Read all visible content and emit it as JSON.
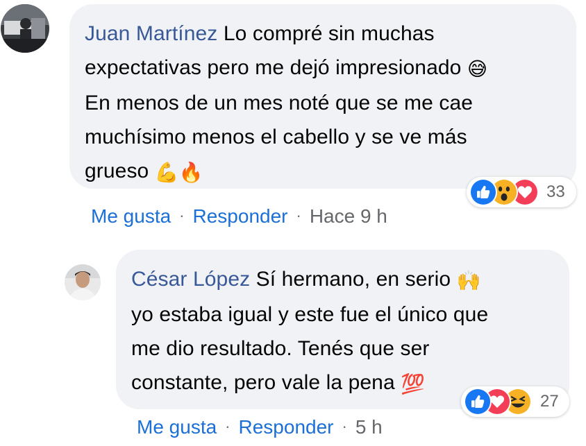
{
  "comments": [
    {
      "author": "Juan Martínez",
      "lines": [
        " Lo compré sin muchas",
        "expectativas pero me dejó impresionado ",
        "En menos de un mes noté que se me cae",
        "muchísimo menos el cabello y se ve más",
        "grueso "
      ],
      "emojis": [
        "😅",
        "💪",
        "🔥"
      ],
      "reactions": {
        "icons": [
          "like-icon",
          "wow-icon",
          "love-icon"
        ],
        "count": "33"
      },
      "actions": {
        "like": "Me gusta",
        "reply": "Responder",
        "separator": "·",
        "time": "Hace 9 h"
      }
    },
    {
      "author": "César López",
      "lines": [
        " Sí hermano, en serio ",
        "yo estaba igual y este fue el único que",
        "me dio resultado. Tenés que ser",
        "constante, pero vale la pena "
      ],
      "emojis": [
        "🙌",
        "💯"
      ],
      "reactions": {
        "icons": [
          "like-icon",
          "love-icon",
          "haha-icon"
        ],
        "count": "27"
      },
      "actions": {
        "like": "Me gusta",
        "reply": "Responder",
        "separator": "·",
        "time": "5 h"
      }
    }
  ],
  "colors": {
    "author": "#385898",
    "link": "#1b6fd6",
    "meta": "#65676b",
    "bubble": "#f0f2f5",
    "like": "#1877f2",
    "love": "#f33e58",
    "wow": "#f7b125"
  }
}
